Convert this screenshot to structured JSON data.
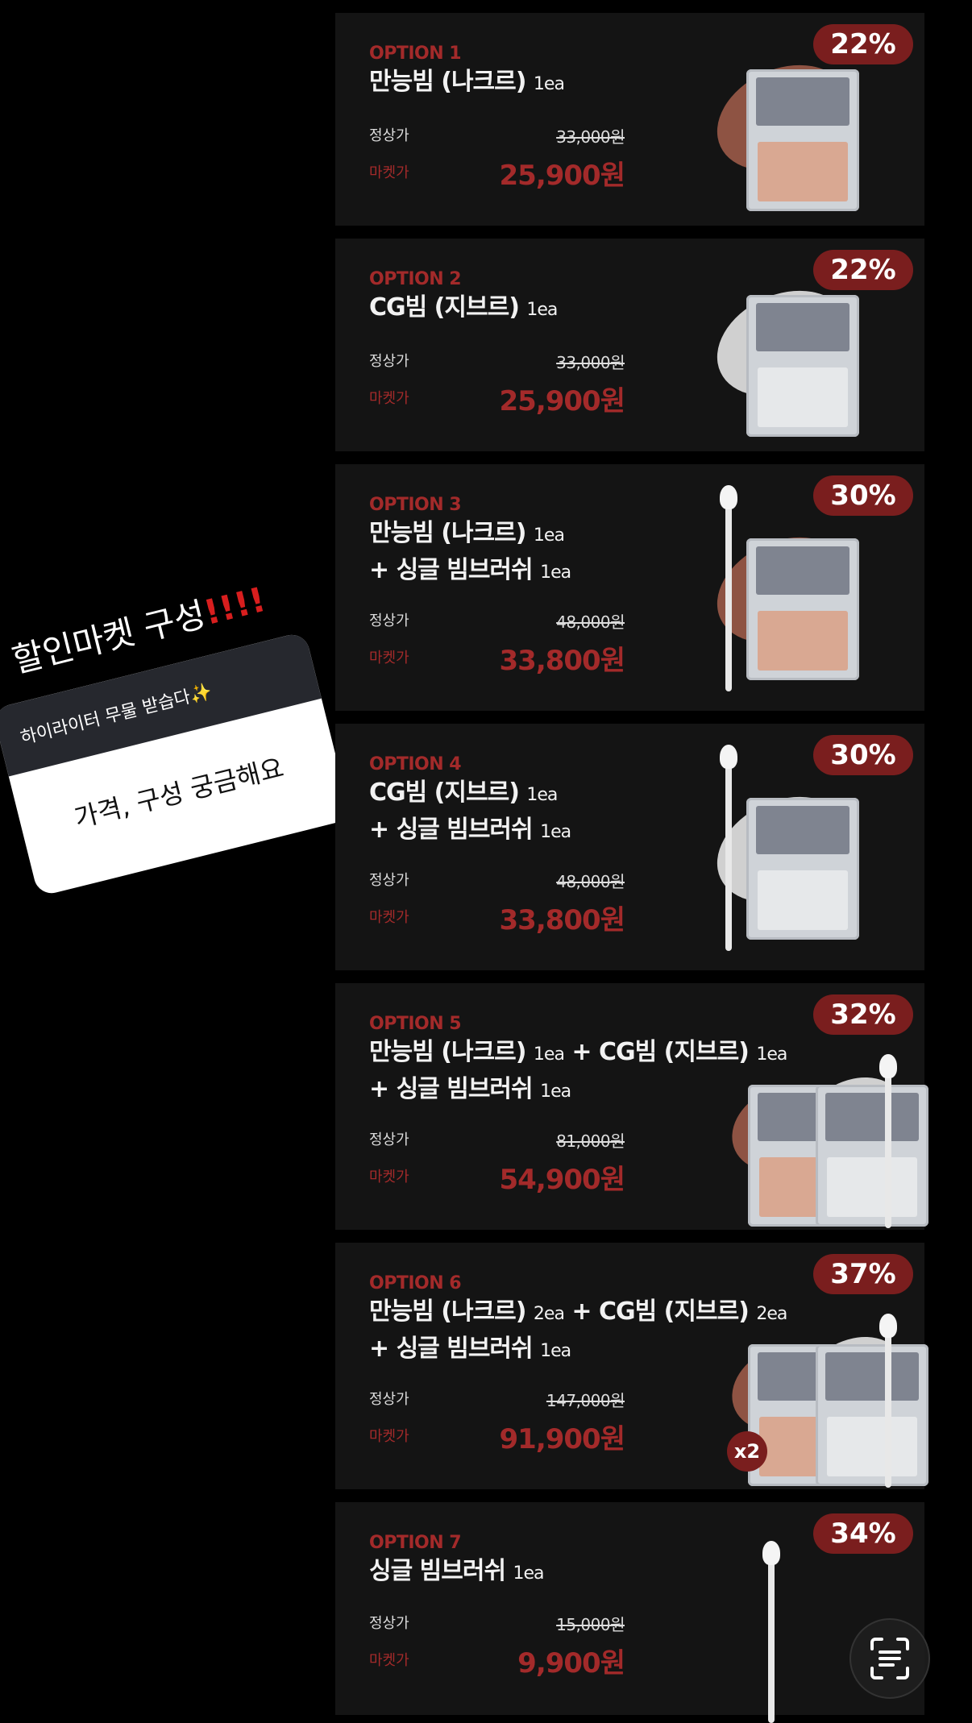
{
  "overlay": {
    "title": "할인마켓 구성",
    "title_marks": "!!!!",
    "question_prompt": "하이라이터 무물 받습다✨",
    "question_answer": "가격, 구성 궁금해요"
  },
  "labels": {
    "regular_price": "정상가",
    "market_price": "마켓가"
  },
  "options": [
    {
      "label": "OPTION 1",
      "lines": [
        [
          [
            "만능빔 (나크르)",
            "1ea"
          ]
        ]
      ],
      "discount": "22%",
      "original": "33,000원",
      "sale": "25,900원"
    },
    {
      "label": "OPTION 2",
      "lines": [
        [
          [
            "CG빔 (지브르)",
            "1ea"
          ]
        ]
      ],
      "discount": "22%",
      "original": "33,000원",
      "sale": "25,900원"
    },
    {
      "label": "OPTION 3",
      "lines": [
        [
          [
            "만능빔 (나크르)",
            "1ea"
          ]
        ],
        [
          [
            "+ 싱글 빔브러쉬",
            "1ea"
          ]
        ]
      ],
      "discount": "30%",
      "original": "48,000원",
      "sale": "33,800원"
    },
    {
      "label": "OPTION 4",
      "lines": [
        [
          [
            "CG빔 (지브르)",
            "1ea"
          ]
        ],
        [
          [
            "+ 싱글 빔브러쉬",
            "1ea"
          ]
        ]
      ],
      "discount": "30%",
      "original": "48,000원",
      "sale": "33,800원"
    },
    {
      "label": "OPTION 5",
      "lines": [
        [
          [
            "만능빔 (나크르)",
            "1ea"
          ],
          [
            "+ CG빔 (지브르)",
            "1ea"
          ]
        ],
        [
          [
            "+ 싱글 빔브러쉬",
            "1ea"
          ]
        ]
      ],
      "discount": "32%",
      "original": "81,000원",
      "sale": "54,900원"
    },
    {
      "label": "OPTION 6",
      "lines": [
        [
          [
            "만능빔 (나크르)",
            "2ea"
          ],
          [
            "+ CG빔 (지브르)",
            "2ea"
          ]
        ],
        [
          [
            "+ 싱글 빔브러쉬",
            "1ea"
          ]
        ]
      ],
      "discount": "37%",
      "original": "147,000원",
      "sale": "91,900원",
      "multiplier": "x2"
    },
    {
      "label": "OPTION 7",
      "lines": [
        [
          [
            "싱글 빔브러쉬",
            "1ea"
          ]
        ]
      ],
      "discount": "34%",
      "original": "15,000원",
      "sale": "9,900원"
    }
  ],
  "icons": {
    "scan_button": "text-scan-icon"
  },
  "colors": {
    "accent": "#a32a2a",
    "badge": "#7a1e1e",
    "panel": "#141414"
  }
}
